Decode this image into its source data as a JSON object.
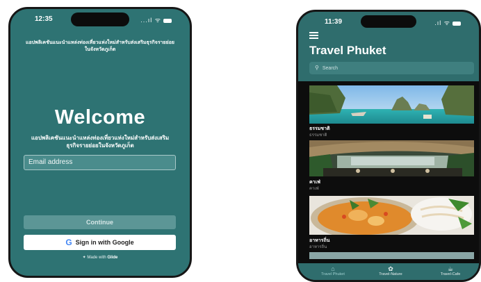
{
  "login_screen": {
    "status_time": "12:35",
    "status_signal": "...ıl ᯤ",
    "top_description": "แอปพลิเคชันแนะนำแหล่งท่องเที่ยวแห่งใหม่สำหรับส่งเสริมธุรกิจรายย่อยในจังหวัดภูเก็ต",
    "welcome": "Welcome",
    "description": "แอปพลิเคชันแนะนำแหล่งท่องเที่ยวแห่งใหม่สำหรับส่งเสริมธุรกิจรายย่อยในจังหวัดภูเก็ต",
    "email_placeholder": "Email address",
    "continue_label": "Continue",
    "google_label": "Sign in with Google",
    "made_with": "Made with",
    "made_with_brand": "Glide"
  },
  "travel_screen": {
    "status_time": "11:39",
    "status_signal": ".ıl ᯤ",
    "title": "Travel Phuket",
    "search_placeholder": "Search",
    "cards": [
      {
        "title": "ธรรมชาติ",
        "subtitle": "ธรรมชาติ"
      },
      {
        "title": "คาเฟ่",
        "subtitle": "คาเฟ่"
      },
      {
        "title": "อาหารถิ่น",
        "subtitle": "อาหารถิ่น"
      }
    ],
    "tabs": [
      {
        "label": "Travel Phuket",
        "icon": "home-icon"
      },
      {
        "label": "Travel-Nature",
        "icon": "leaf-icon"
      },
      {
        "label": "Travel-Cafe",
        "icon": "coffee-icon"
      }
    ]
  },
  "colors": {
    "teal_background": "#2e7373",
    "feed_background": "#0d0d0d",
    "google_blue": "#4285f4"
  }
}
